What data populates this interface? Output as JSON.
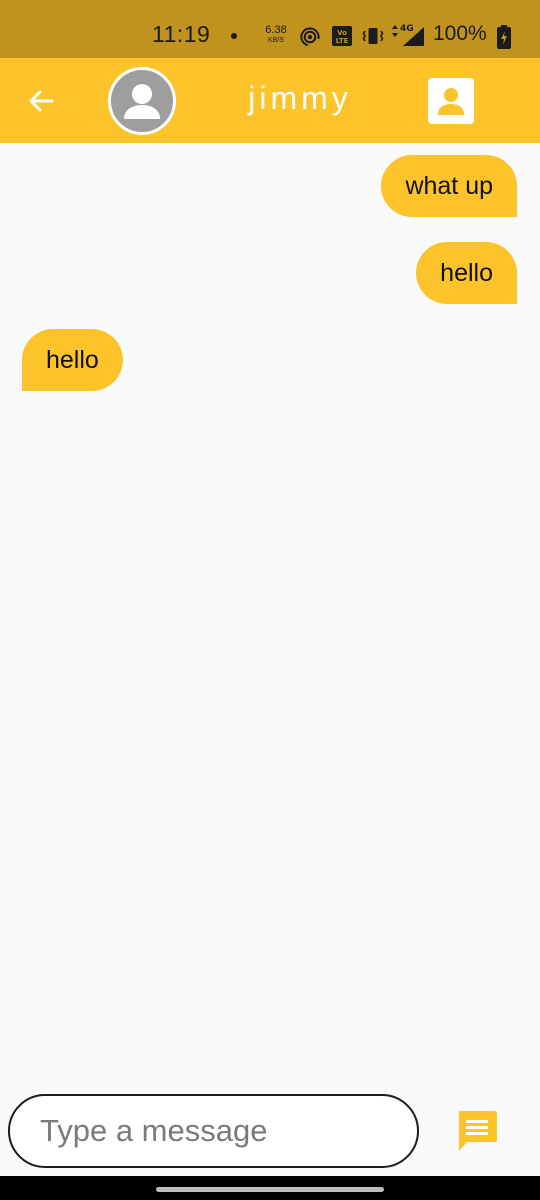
{
  "status_bar": {
    "time": "11:19",
    "net_speed": "6.38",
    "net_speed_unit": "KB/S",
    "network_type": "4G",
    "battery": "100%"
  },
  "app_bar": {
    "title": "jimmy"
  },
  "messages": [
    {
      "text": "what up",
      "direction": "sent"
    },
    {
      "text": "hello",
      "direction": "sent"
    },
    {
      "text": "hello",
      "direction": "received"
    }
  ],
  "composer": {
    "placeholder": "Type a message",
    "value": ""
  },
  "colors": {
    "status_bar": "#c0931f",
    "accent": "#fcc32b",
    "background": "#fafafa",
    "avatar_gray": "#9e9e9e"
  },
  "icons": {
    "back": "arrow-left-icon",
    "avatar": "person-icon",
    "contact": "contact-card-icon",
    "send": "message-icon"
  }
}
